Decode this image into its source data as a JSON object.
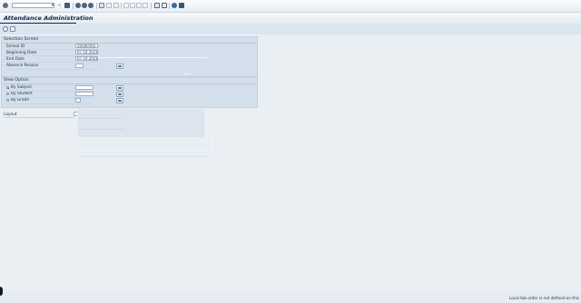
{
  "window": {
    "title": "Attendance Administration",
    "command_field_value": ""
  },
  "toolbar": {
    "icons": [
      "enter-icon",
      "command-dropdown-icon",
      "back-arrows-icon",
      "save-icon",
      "back-icon",
      "exit-icon",
      "cancel-icon",
      "print-icon",
      "find-icon",
      "find-next-icon",
      "first-page-icon",
      "prev-page-icon",
      "next-page-icon",
      "last-page-icon",
      "new-session-icon",
      "shortcut-icon",
      "help-icon",
      "customize-icon"
    ]
  },
  "app_toolbar": {
    "icons": [
      "execute-icon",
      "variant-icon"
    ]
  },
  "selection_screen": {
    "title": "Selection Screen",
    "school_id_label": "School ID",
    "school_id_value": "50000165",
    "beginning_date_label": "Beginning Date",
    "beginning_date_value": "07.10.2021",
    "end_date_label": "End Date",
    "end_date_value": "07.10.2021",
    "absence_reason_label": "Absence Reason",
    "absence_reason_value": ""
  },
  "view_option": {
    "title": "View Option",
    "options": [
      {
        "label": "By Subject",
        "selected": true
      },
      {
        "label": "By Student",
        "selected": false
      },
      {
        "label": "By Grade",
        "selected": false
      }
    ]
  },
  "layout_field": {
    "label": "Layout",
    "value": ""
  },
  "status": {
    "text": "Local tab order is not defined on this"
  },
  "colors": {
    "background": "#eaeff4",
    "group_background": "#d3e0ec",
    "title_color": "#0e2b4f"
  }
}
